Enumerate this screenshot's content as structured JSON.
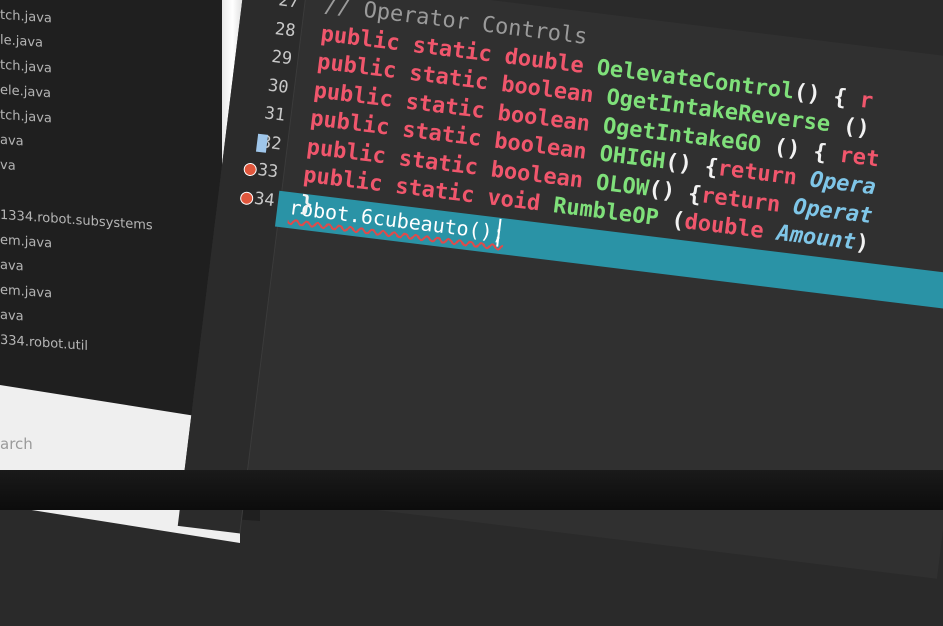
{
  "explorer": {
    "files": [
      "tch.java",
      "le.java",
      "tch.java",
      "ele.java",
      "tch.java",
      "ava",
      "va",
      "",
      "1334.robot.subsystems",
      "em.java",
      "ava",
      "em.java",
      "ava",
      "334.robot.util"
    ],
    "search_label": "arch"
  },
  "editor": {
    "lines": [
      {
        "number": "27",
        "tokens": [
          {
            "t": "// Operator Controls",
            "c": "cm"
          }
        ]
      },
      {
        "number": "28",
        "tokens": [
          {
            "t": "public static double ",
            "c": "kw"
          },
          {
            "t": "OelevateControl",
            "c": "fn"
          },
          {
            "t": "() { ",
            "c": "pl"
          },
          {
            "t": "r",
            "c": "kw"
          }
        ]
      },
      {
        "number": "29",
        "tokens": [
          {
            "t": "public static boolean ",
            "c": "kw"
          },
          {
            "t": "OgetIntakeReverse",
            "c": "fn"
          },
          {
            "t": " ()",
            "c": "pl"
          }
        ]
      },
      {
        "number": "30",
        "tokens": [
          {
            "t": "public static boolean ",
            "c": "kw"
          },
          {
            "t": "OgetIntakeGO",
            "c": "fn"
          },
          {
            "t": " () { ",
            "c": "pl"
          },
          {
            "t": "ret",
            "c": "kw"
          }
        ]
      },
      {
        "number": "31",
        "tokens": [
          {
            "t": "public static boolean ",
            "c": "kw"
          },
          {
            "t": "OHIGH",
            "c": "fn"
          },
          {
            "t": "() {",
            "c": "pl"
          },
          {
            "t": "return ",
            "c": "kw"
          },
          {
            "t": "Opera",
            "c": "it"
          }
        ]
      },
      {
        "number": "32",
        "tokens": [
          {
            "t": "public static boolean ",
            "c": "kw"
          },
          {
            "t": "OLOW",
            "c": "fn"
          },
          {
            "t": "() {",
            "c": "pl"
          },
          {
            "t": "return ",
            "c": "kw"
          },
          {
            "t": "Operat",
            "c": "it"
          }
        ]
      },
      {
        "number": "33",
        "tokens": [
          {
            "t": "public static void ",
            "c": "kw"
          },
          {
            "t": "RumbleOP",
            "c": "fn"
          },
          {
            "t": " (",
            "c": "pl"
          },
          {
            "t": "double ",
            "c": "kw"
          },
          {
            "t": "Amount",
            "c": "it"
          },
          {
            "t": ") ",
            "c": "pl"
          }
        ]
      },
      {
        "number": "34",
        "tokens": [
          {
            "t": "}",
            "c": "pl"
          }
        ]
      }
    ],
    "selected_line": "robot.6cubeauto();"
  }
}
